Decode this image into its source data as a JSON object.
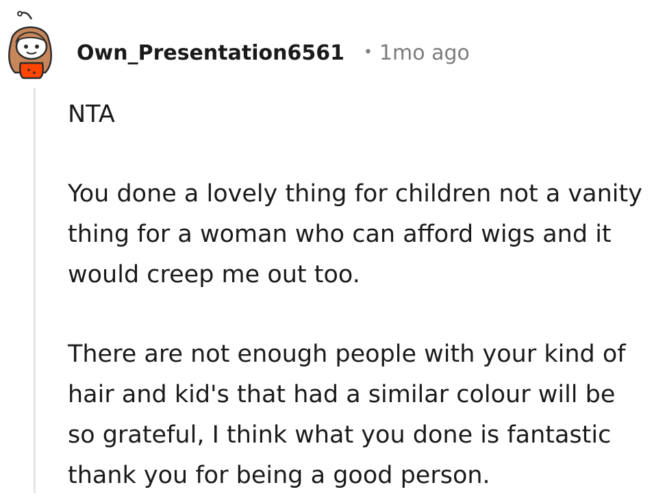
{
  "comment": {
    "author": "Own_Presentation6561",
    "separator": "•",
    "timestamp": "1mo ago",
    "avatar_icon": "snoo-avatar-icon",
    "paragraphs": [
      "NTA",
      "You done a lovely thing for children not a vanity thing for a woman who can afford wigs and it would creep me out too.",
      "There are not enough people with your kind of hair and kid's that had a similar colour will be so grateful, I think what you done is fantastic thank you for being a good person."
    ]
  },
  "colors": {
    "text": "#1a1a1b",
    "meta": "#7c7c7c",
    "thread_line": "#e5e5e5",
    "avatar_hair": "#c8875a",
    "avatar_shirt": "#ff4500"
  }
}
